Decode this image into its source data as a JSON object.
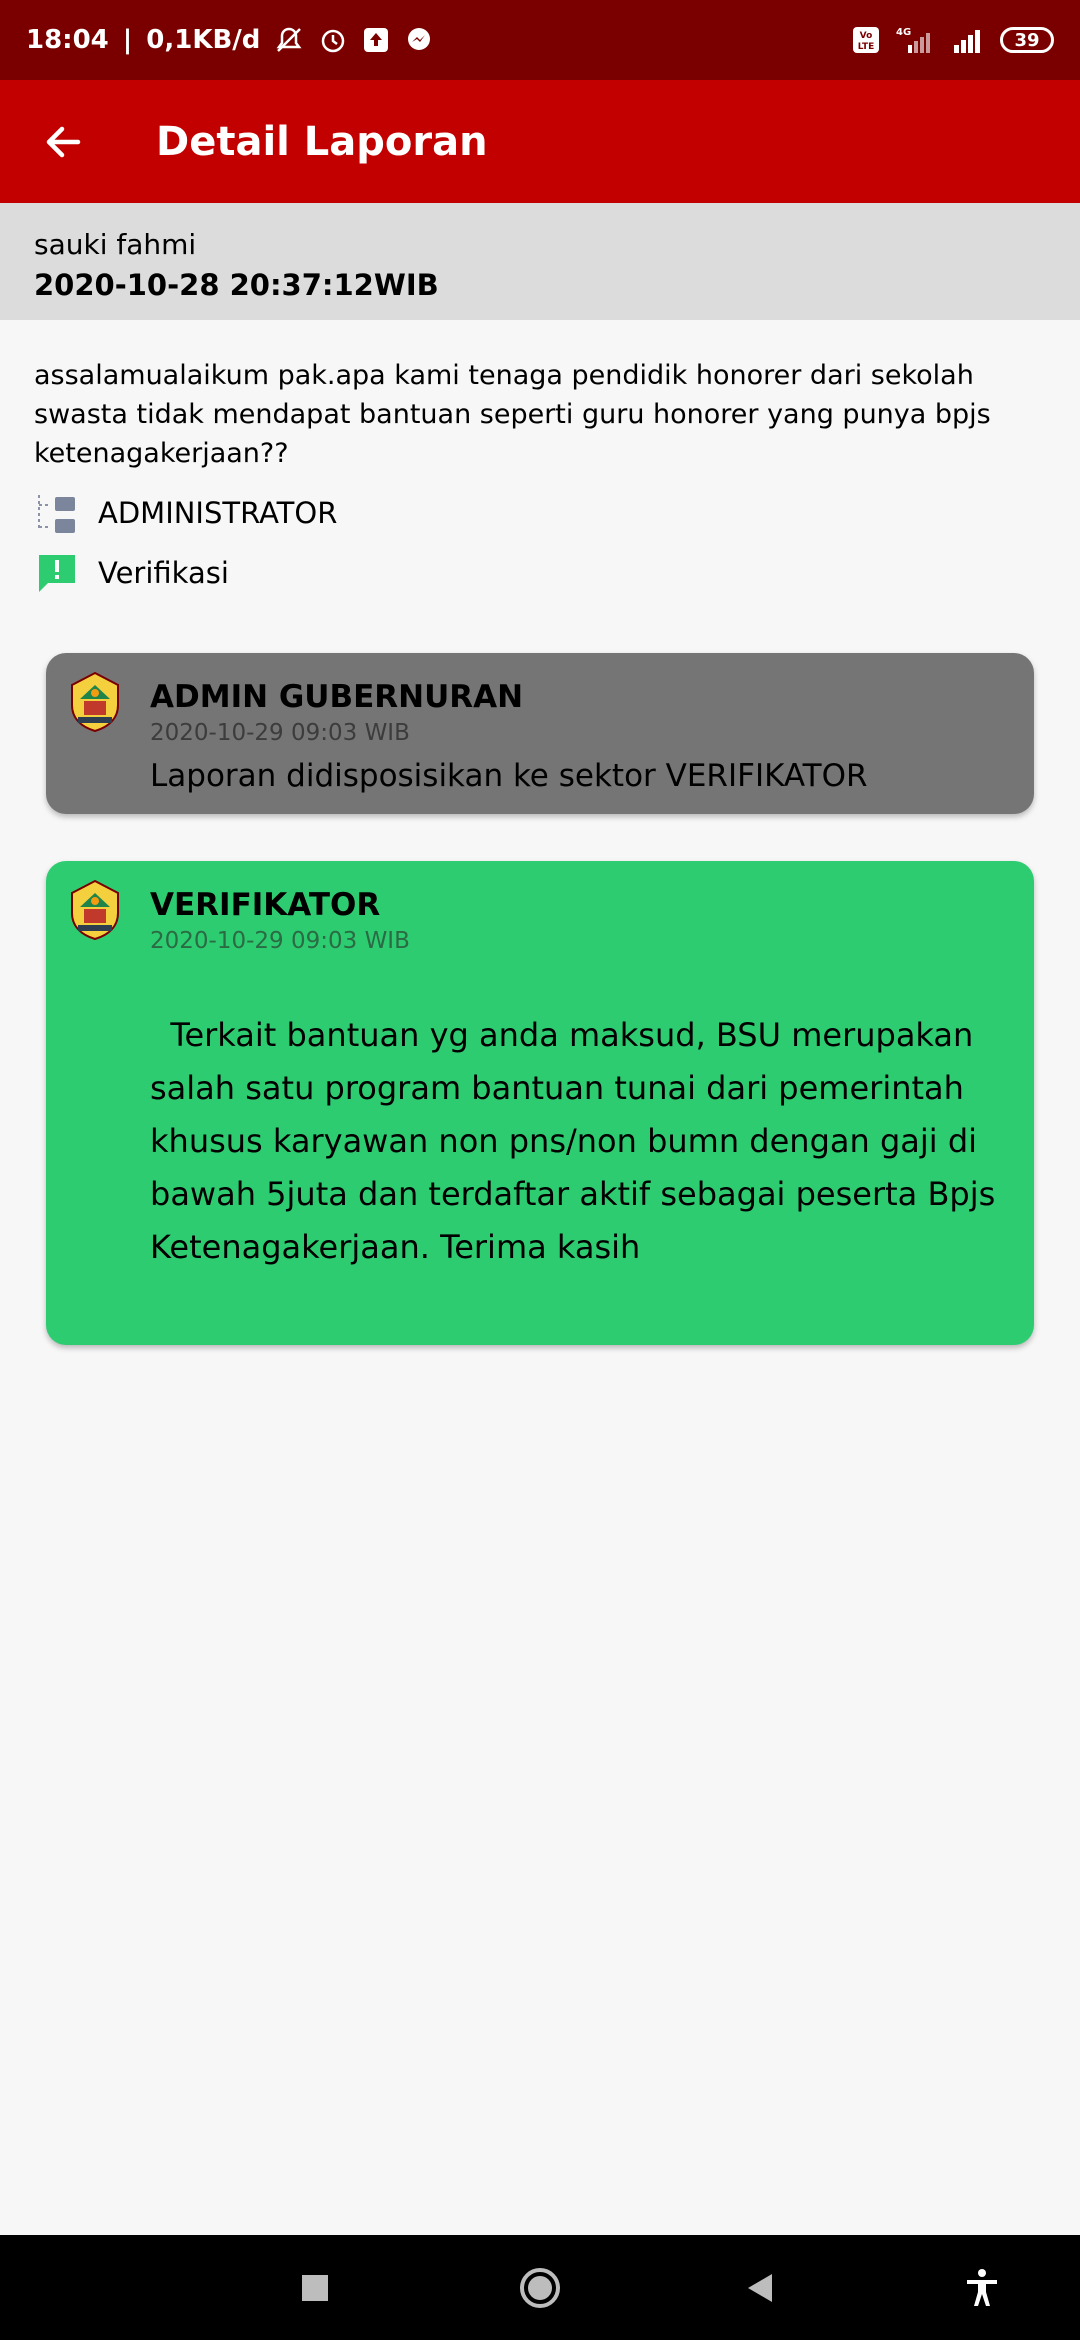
{
  "status_bar": {
    "time": "18:04",
    "speed": "0,1KB/d",
    "battery": "39",
    "network_label": "4G",
    "volte_label": "Vo LTE"
  },
  "app_bar": {
    "title": "Detail Laporan"
  },
  "report": {
    "reporter": "sauki fahmi",
    "date": "2020-10-28 20:37:12WIB",
    "body": "assalamualaikum pak.apa kami tenaga pendidik honorer dari sekolah swasta tidak mendapat bantuan seperti guru honorer yang punya bpjs ketenagakerjaan??",
    "category": "ADMINISTRATOR",
    "status": "Verifikasi"
  },
  "timeline": [
    {
      "sender": "ADMIN GUBERNURAN",
      "time": "2020-10-29 09:03 WIB",
      "message": "Laporan didisposisikan ke sektor VERIFIKATOR"
    },
    {
      "sender": "VERIFIKATOR",
      "time": "2020-10-29 09:03 WIB",
      "message": "  Terkait bantuan yg anda maksud, BSU merupakan salah satu program bantuan tunai dari pemerintah khusus karyawan non pns/non bumn dengan gaji di bawah 5juta dan terdaftar aktif sebagai peserta Bpjs Ketenagakerjaan. Terima kasih"
    }
  ],
  "colors": {
    "status_bar": "#7a0000",
    "app_bar": "#c20000",
    "card_gray": "#757575",
    "card_green": "#2ecc71",
    "status_green": "#2ecc71"
  },
  "icons": {
    "back": "arrow-back-icon",
    "category": "category-tree-icon",
    "status": "alert-message-icon",
    "logo": "province-emblem-icon"
  }
}
